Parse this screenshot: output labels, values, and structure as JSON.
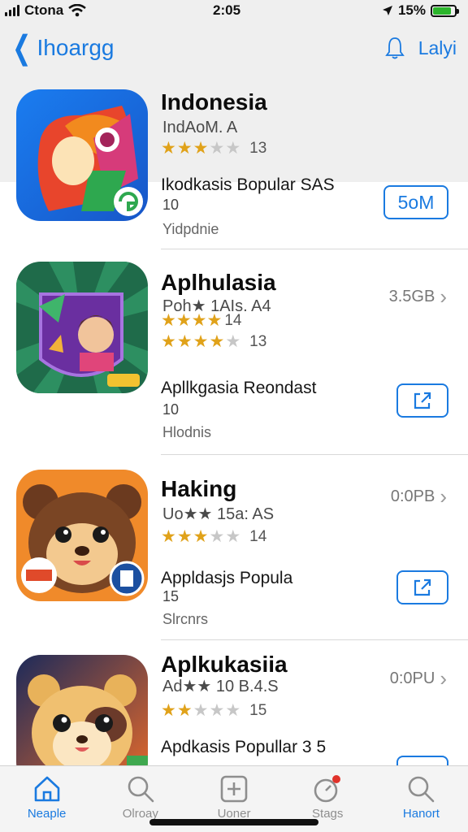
{
  "status_bar": {
    "carrier": "Ctona",
    "time": "2:05",
    "battery": "15%",
    "battery_level": 0.85
  },
  "nav": {
    "back_label": "Ihoargg",
    "right_label": "Lalyi"
  },
  "apps": [
    {
      "title": "Indonesia",
      "subtitle": "IndAoM. A",
      "rating": 3,
      "rating_count": "13",
      "description": "Ikodkasis Bopular SAS",
      "number": "10",
      "category": "Yidpdnie",
      "size": "",
      "button_label": "5oM",
      "button_icon": ""
    },
    {
      "title": "Aplhulasia",
      "subtitle": "Poh★ 1AIs. A4",
      "rating_small": "4",
      "rating_small_count": "14",
      "rating": 4,
      "rating_count": "13",
      "description": "Apllkgasia Reondast",
      "number": "10",
      "category": "Hlodnis",
      "size": "3.5GB",
      "button_label": "",
      "button_icon": "open-icon"
    },
    {
      "title": "Haking",
      "subtitle": "Uo★★ 15a: AS",
      "rating": 3,
      "rating_count": "14",
      "description": "Appldasjs Popula",
      "number": "15",
      "category": "Slrcnrs",
      "size": "0:0PB",
      "button_label": "",
      "button_icon": "open-icon"
    },
    {
      "title": "Aplkukasiia",
      "subtitle": "Ad★★ 10 B.4.S",
      "rating": 2,
      "rating_count": "15",
      "description": "Apdkasis Popullar 3 5",
      "number": "",
      "category": "",
      "size": "0:0PU",
      "button_label": "",
      "button_icon": "open-icon"
    }
  ],
  "tabs": [
    {
      "label": "Neaple",
      "icon": "home-icon",
      "active": true
    },
    {
      "label": "Olroay",
      "icon": "search-icon",
      "active": false
    },
    {
      "label": "Uoner",
      "icon": "add-icon",
      "active": false
    },
    {
      "label": "Stags",
      "icon": "updates-icon",
      "active": false
    },
    {
      "label": "Hanort",
      "icon": "search-icon",
      "active": false
    }
  ],
  "colors": {
    "accent": "#1a7ae0",
    "star": "#e0a21a",
    "badge": "#e0322a"
  }
}
